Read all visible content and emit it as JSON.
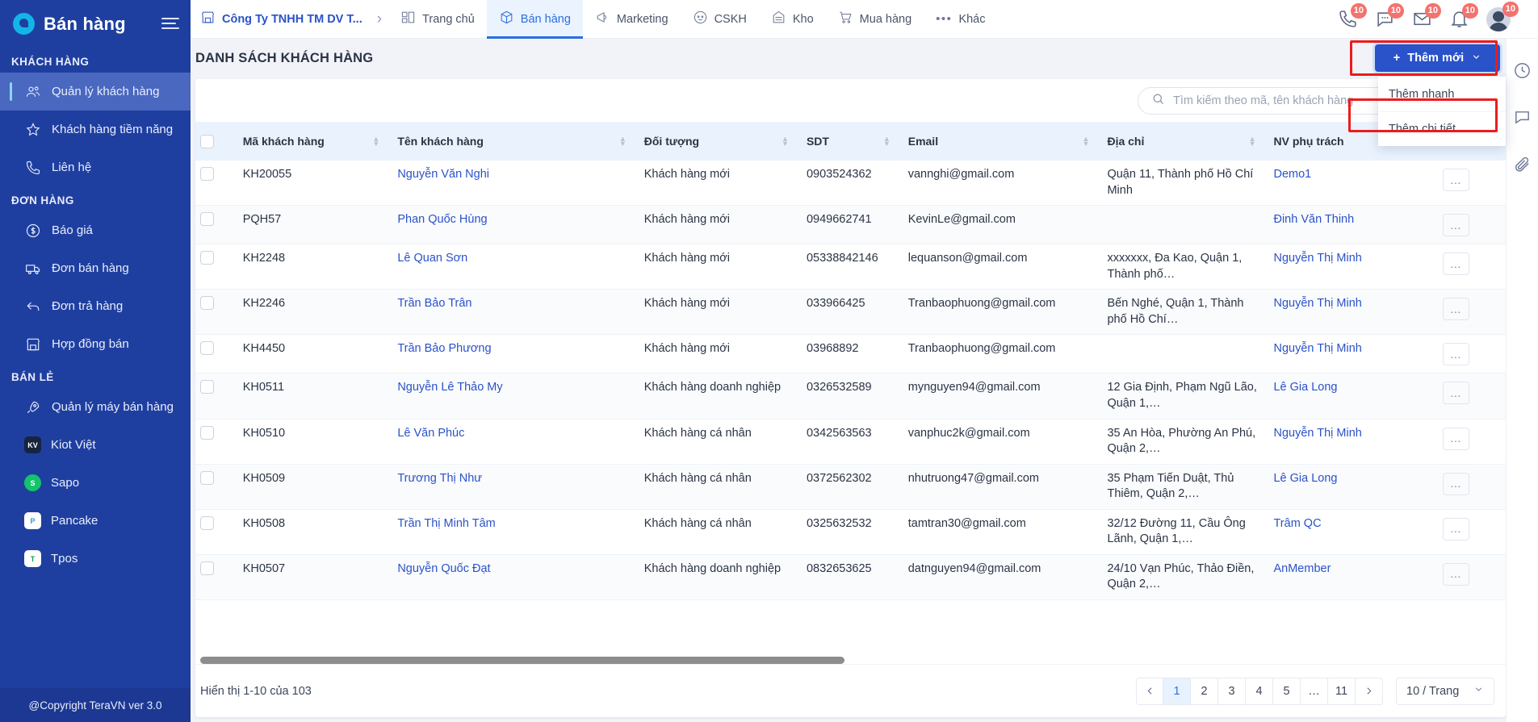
{
  "sidebar": {
    "brand": "Bán hàng",
    "copyright": "@Copyright TeraVN ver 3.0",
    "groups": [
      {
        "label": "KHÁCH HÀNG",
        "items": [
          {
            "label": "Quản lý khách hàng",
            "icon": "users-icon",
            "active": true
          },
          {
            "label": "Khách hàng tiềm năng",
            "icon": "star-icon",
            "active": false
          },
          {
            "label": "Liên hệ",
            "icon": "phone-icon",
            "active": false
          }
        ]
      },
      {
        "label": "ĐƠN HÀNG",
        "items": [
          {
            "label": "Báo giá",
            "icon": "dollar-circle-icon",
            "active": false
          },
          {
            "label": "Đơn bán hàng",
            "icon": "truck-icon",
            "active": false
          },
          {
            "label": "Đơn trả hàng",
            "icon": "return-arrow-icon",
            "active": false
          },
          {
            "label": "Hợp đồng bán",
            "icon": "store-icon",
            "active": false
          }
        ]
      },
      {
        "label": "BÁN LẺ",
        "items": [
          {
            "label": "Quản lý máy bán hàng",
            "icon": "rocket-icon",
            "active": false
          },
          {
            "label": "Kiot Việt",
            "icon": "kiotviet-logo-icon",
            "active": false,
            "badge_color": "#16243f",
            "badge_text": "KV"
          },
          {
            "label": "Sapo",
            "icon": "sapo-logo-icon",
            "active": false,
            "badge_color": "#12c46a",
            "badge_text": "S"
          },
          {
            "label": "Pancake",
            "icon": "pancake-logo-icon",
            "active": false,
            "badge_color": "#ffffff",
            "badge_text": "P"
          },
          {
            "label": "Tpos",
            "icon": "tpos-logo-icon",
            "active": false,
            "badge_color": "#0f9d58",
            "badge_text": "T"
          }
        ]
      }
    ]
  },
  "topbar": {
    "breadcrumb": "Công Ty TNHH TM DV T...",
    "tabs": [
      {
        "label": "Trang chủ",
        "icon": "dashboard-icon",
        "active": false
      },
      {
        "label": "Bán hàng",
        "icon": "box-icon",
        "active": true
      },
      {
        "label": "Marketing",
        "icon": "megaphone-icon",
        "active": false
      },
      {
        "label": "CSKH",
        "icon": "headset-icon",
        "active": false
      },
      {
        "label": "Kho",
        "icon": "warehouse-icon",
        "active": false
      },
      {
        "label": "Mua hàng",
        "icon": "cart-icon",
        "active": false
      },
      {
        "label": "Khác",
        "icon": "ellipsis-icon",
        "active": false
      }
    ],
    "notifications": [
      {
        "icon": "phone-icon",
        "count": "10"
      },
      {
        "icon": "chat-icon",
        "count": "10"
      },
      {
        "icon": "mail-icon",
        "count": "10"
      },
      {
        "icon": "bell-icon",
        "count": "10"
      }
    ],
    "avatar_badge": "10"
  },
  "page": {
    "title": "DANH SÁCH KHÁCH HÀNG",
    "add_button": "Thêm mới",
    "dropdown": [
      {
        "label": "Thêm nhanh",
        "highlighted": false
      },
      {
        "label": "Thêm chi tiết",
        "highlighted": true
      }
    ]
  },
  "search": {
    "value": "",
    "placeholder": "Tìm kiếm theo mã, tên khách hàng"
  },
  "table": {
    "columns": [
      {
        "label": "Mã khách hàng",
        "sortable": true
      },
      {
        "label": "Tên khách hàng",
        "sortable": true
      },
      {
        "label": "Đối tượng",
        "sortable": true
      },
      {
        "label": "SDT",
        "sortable": true
      },
      {
        "label": "Email",
        "sortable": true
      },
      {
        "label": "Địa chỉ",
        "sortable": true
      },
      {
        "label": "NV phụ trách",
        "sortable": false
      }
    ],
    "rows": [
      {
        "code": "KH20055",
        "name": "Nguyễn Văn Nghi",
        "type": "Khách hàng mới",
        "phone": "0903524362",
        "email": "vannghi@gmail.com",
        "address": "Quận 11, Thành phố Hồ Chí Minh",
        "staff": "Demo1"
      },
      {
        "code": "PQH57",
        "name": "Phan Quốc Hùng",
        "type": "Khách hàng mới",
        "phone": "0949662741",
        "email": "KevinLe@gmail.com",
        "address": "",
        "staff": "Đinh Văn Thinh"
      },
      {
        "code": "KH2248",
        "name": "Lê Quan Sơn",
        "type": "Khách hàng mới",
        "phone": "05338842146",
        "email": "lequanson@gmail.com",
        "address": "xxxxxxx, Đa Kao, Quận 1, Thành phố…",
        "staff": "Nguyễn Thị Minh"
      },
      {
        "code": "KH2246",
        "name": "Trần Bảo Trân",
        "type": "Khách hàng mới",
        "phone": "033966425",
        "email": "Tranbaophuong@gmail.com",
        "address": "Bến Nghé, Quận 1, Thành phố Hồ Chí…",
        "staff": "Nguyễn Thị Minh"
      },
      {
        "code": "KH4450",
        "name": "Trần Bảo Phương",
        "type": "Khách hàng mới",
        "phone": "03968892",
        "email": "Tranbaophuong@gmail.com",
        "address": "",
        "staff": "Nguyễn Thị Minh"
      },
      {
        "code": "KH0511",
        "name": "Nguyễn Lê Thảo My",
        "type": "Khách hàng doanh nghiệp",
        "phone": "0326532589",
        "email": "mynguyen94@gmail.com",
        "address": "12 Gia Định, Phạm Ngũ Lão, Quận 1,…",
        "staff": "Lê Gia Long"
      },
      {
        "code": "KH0510",
        "name": "Lê Văn Phúc",
        "type": "Khách hàng cá nhân",
        "phone": "0342563563",
        "email": "vanphuc2k@gmail.com",
        "address": "35 An Hòa, Phường An Phú, Quận 2,…",
        "staff": "Nguyễn Thị Minh"
      },
      {
        "code": "KH0509",
        "name": "Trương Thị Như",
        "type": "Khách hàng cá nhân",
        "phone": "0372562302",
        "email": "nhutruong47@gmail.com",
        "address": "35 Phạm Tiến Duật, Thủ Thiêm, Quận 2,…",
        "staff": "Lê Gia Long"
      },
      {
        "code": "KH0508",
        "name": "Trần Thị Minh Tâm",
        "type": "Khách hàng cá nhân",
        "phone": "0325632532",
        "email": "tamtran30@gmail.com",
        "address": "32/12 Đường 11, Cầu Ông Lãnh, Quận 1,…",
        "staff": "Trâm QC"
      },
      {
        "code": "KH0507",
        "name": "Nguyễn Quốc Đạt",
        "type": "Khách hàng doanh nghiệp",
        "phone": "0832653625",
        "email": "datnguyen94@gmail.com",
        "address": "24/10 Vạn Phúc, Thảo Điền, Quận 2,…",
        "staff": "AnMember"
      }
    ],
    "row_action": "…"
  },
  "footer": {
    "showing": "Hiển thị 1-10 của 103",
    "pages": [
      "1",
      "2",
      "3",
      "4",
      "5",
      "…",
      "11"
    ],
    "active_page": "1",
    "per_page": "10 / Trang"
  },
  "rail": [
    {
      "icon": "clock-icon"
    },
    {
      "icon": "chat-bubble-icon"
    },
    {
      "icon": "paperclip-icon"
    }
  ],
  "colors": {
    "brand": "#1f3fa0",
    "accent": "#2a52c9",
    "highlight": "#ee1b1b",
    "badge": "#f4726e"
  }
}
